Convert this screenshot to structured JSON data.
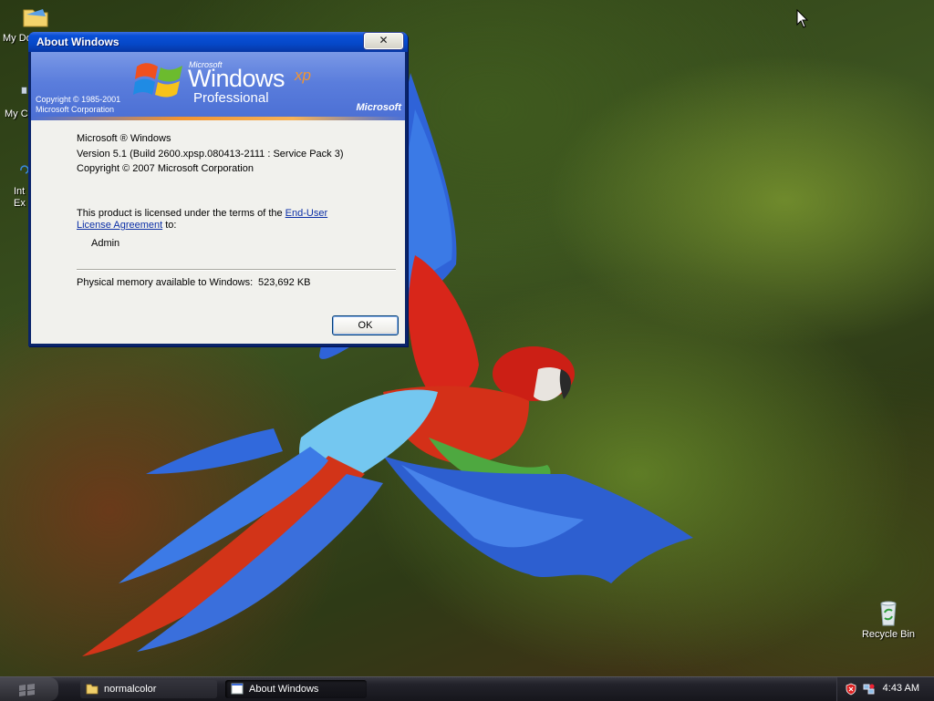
{
  "desktop": {
    "icons": [
      {
        "label": "My Do"
      },
      {
        "label": "My C"
      },
      {
        "label": "Int\nEx"
      },
      {
        "label": "Recycle Bin"
      }
    ]
  },
  "dialog": {
    "title": "About Windows",
    "close_glyph": "✕",
    "banner": {
      "microsoft_small": "Microsoft",
      "windows": "Windows",
      "xp": "xp",
      "edition": "Professional",
      "copyright_line1": "Copyright © 1985-2001",
      "copyright_line2": "Microsoft Corporation",
      "microsoft_logo": "Microsoft"
    },
    "product_line": "Microsoft ® Windows",
    "version_line": "Version 5.1 (Build 2600.xpsp.080413-2111 : Service Pack 3)",
    "copyright_line": "Copyright © 2007 Microsoft Corporation",
    "license_prefix": "This product is licensed under the terms of the ",
    "license_link_1": "End-User",
    "license_link_2": "License Agreement",
    "license_suffix": " to:",
    "licensee": "Admin",
    "memory_label": "Physical memory available to Windows:",
    "memory_value": "523,692 KB",
    "ok_label": "OK"
  },
  "taskbar": {
    "tasks": [
      {
        "label": "normalcolor",
        "icon": "folder-icon"
      },
      {
        "label": "About Windows",
        "icon": "window-icon",
        "active": true
      }
    ],
    "clock": "4:43 AM"
  }
}
